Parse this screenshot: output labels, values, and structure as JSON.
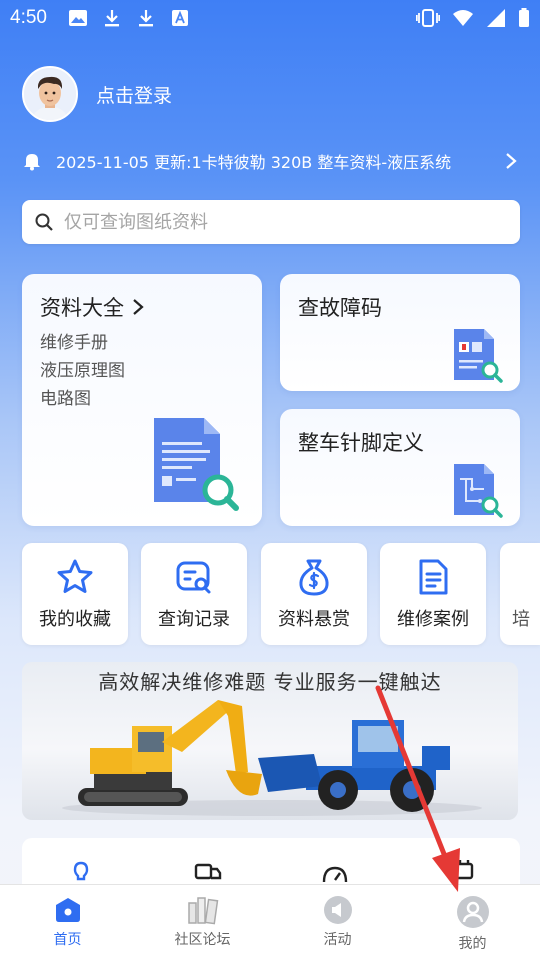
{
  "status_bar": {
    "time": "4:50"
  },
  "profile": {
    "login_text": "点击登录"
  },
  "notice": {
    "text": "2025-11-05 更新:1卡特彼勒 320B 整车资料-液压系统"
  },
  "search": {
    "placeholder": "仅可查询图纸资料"
  },
  "cards": {
    "main": {
      "title": "资料大全",
      "items": [
        "维修手册",
        "液压原理图",
        "电路图"
      ]
    },
    "fault_code": {
      "title": "查故障码"
    },
    "pin_definition": {
      "title": "整车针脚定义"
    }
  },
  "quick_actions": [
    {
      "label": "我的收藏",
      "icon": "star-icon"
    },
    {
      "label": "查询记录",
      "icon": "search-record-icon"
    },
    {
      "label": "资料悬赏",
      "icon": "money-bag-icon"
    },
    {
      "label": "维修案例",
      "icon": "document-icon"
    },
    {
      "label": "培",
      "icon": "partial-icon"
    }
  ],
  "banner": {
    "text": "高效解决维修难题  专业服务一键触达"
  },
  "tabbar": [
    {
      "label": "首页",
      "icon": "home-icon",
      "active": true
    },
    {
      "label": "社区论坛",
      "icon": "books-icon",
      "active": false
    },
    {
      "label": "活动",
      "icon": "megaphone-icon",
      "active": false
    },
    {
      "label": "我的",
      "icon": "user-icon",
      "active": false
    }
  ],
  "colors": {
    "primary": "#2f6df1",
    "annotation_arrow": "#e53935"
  }
}
